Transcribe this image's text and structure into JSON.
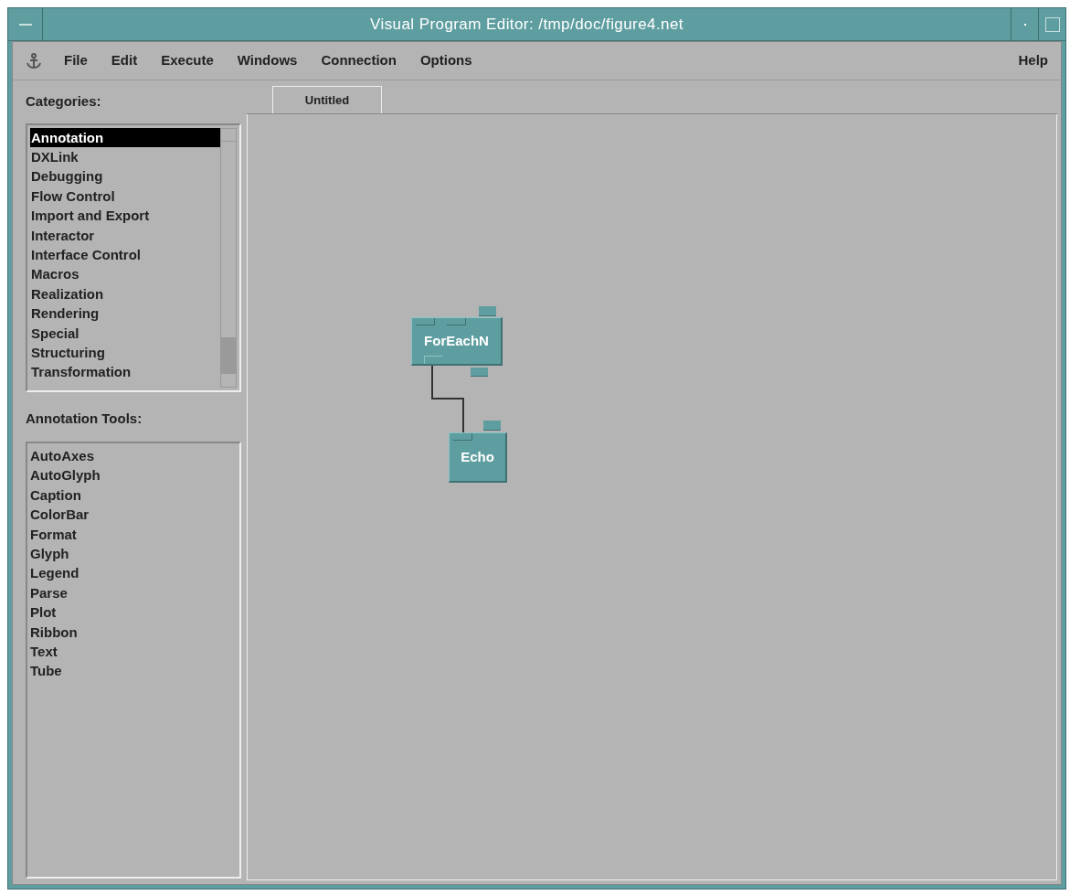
{
  "window": {
    "title": "Visual Program Editor: /tmp/doc/figure4.net"
  },
  "menu": [
    "File",
    "Edit",
    "Execute",
    "Windows",
    "Connection",
    "Options"
  ],
  "help_menu": "Help",
  "categories": {
    "label": "Categories:",
    "items": [
      {
        "label": "Annotation",
        "selected": true
      },
      {
        "label": "DXLink",
        "selected": false
      },
      {
        "label": "Debugging",
        "selected": false
      },
      {
        "label": "Flow Control",
        "selected": false
      },
      {
        "label": "Import and Export",
        "selected": false
      },
      {
        "label": "Interactor",
        "selected": false
      },
      {
        "label": "Interface Control",
        "selected": false
      },
      {
        "label": "Macros",
        "selected": false
      },
      {
        "label": "Realization",
        "selected": false
      },
      {
        "label": "Rendering",
        "selected": false
      },
      {
        "label": "Special",
        "selected": false
      },
      {
        "label": "Structuring",
        "selected": false
      },
      {
        "label": "Transformation",
        "selected": false
      }
    ]
  },
  "tools": {
    "label": "Annotation Tools:",
    "items": [
      "AutoAxes",
      "AutoGlyph",
      "Caption",
      "ColorBar",
      "Format",
      "Glyph",
      "Legend",
      "Parse",
      "Plot",
      "Ribbon",
      "Text",
      "Tube"
    ]
  },
  "tabs": [
    {
      "label": "Untitled",
      "selected": true
    }
  ],
  "nodes": [
    {
      "label": "ForEachN"
    },
    {
      "label": "Echo"
    }
  ]
}
